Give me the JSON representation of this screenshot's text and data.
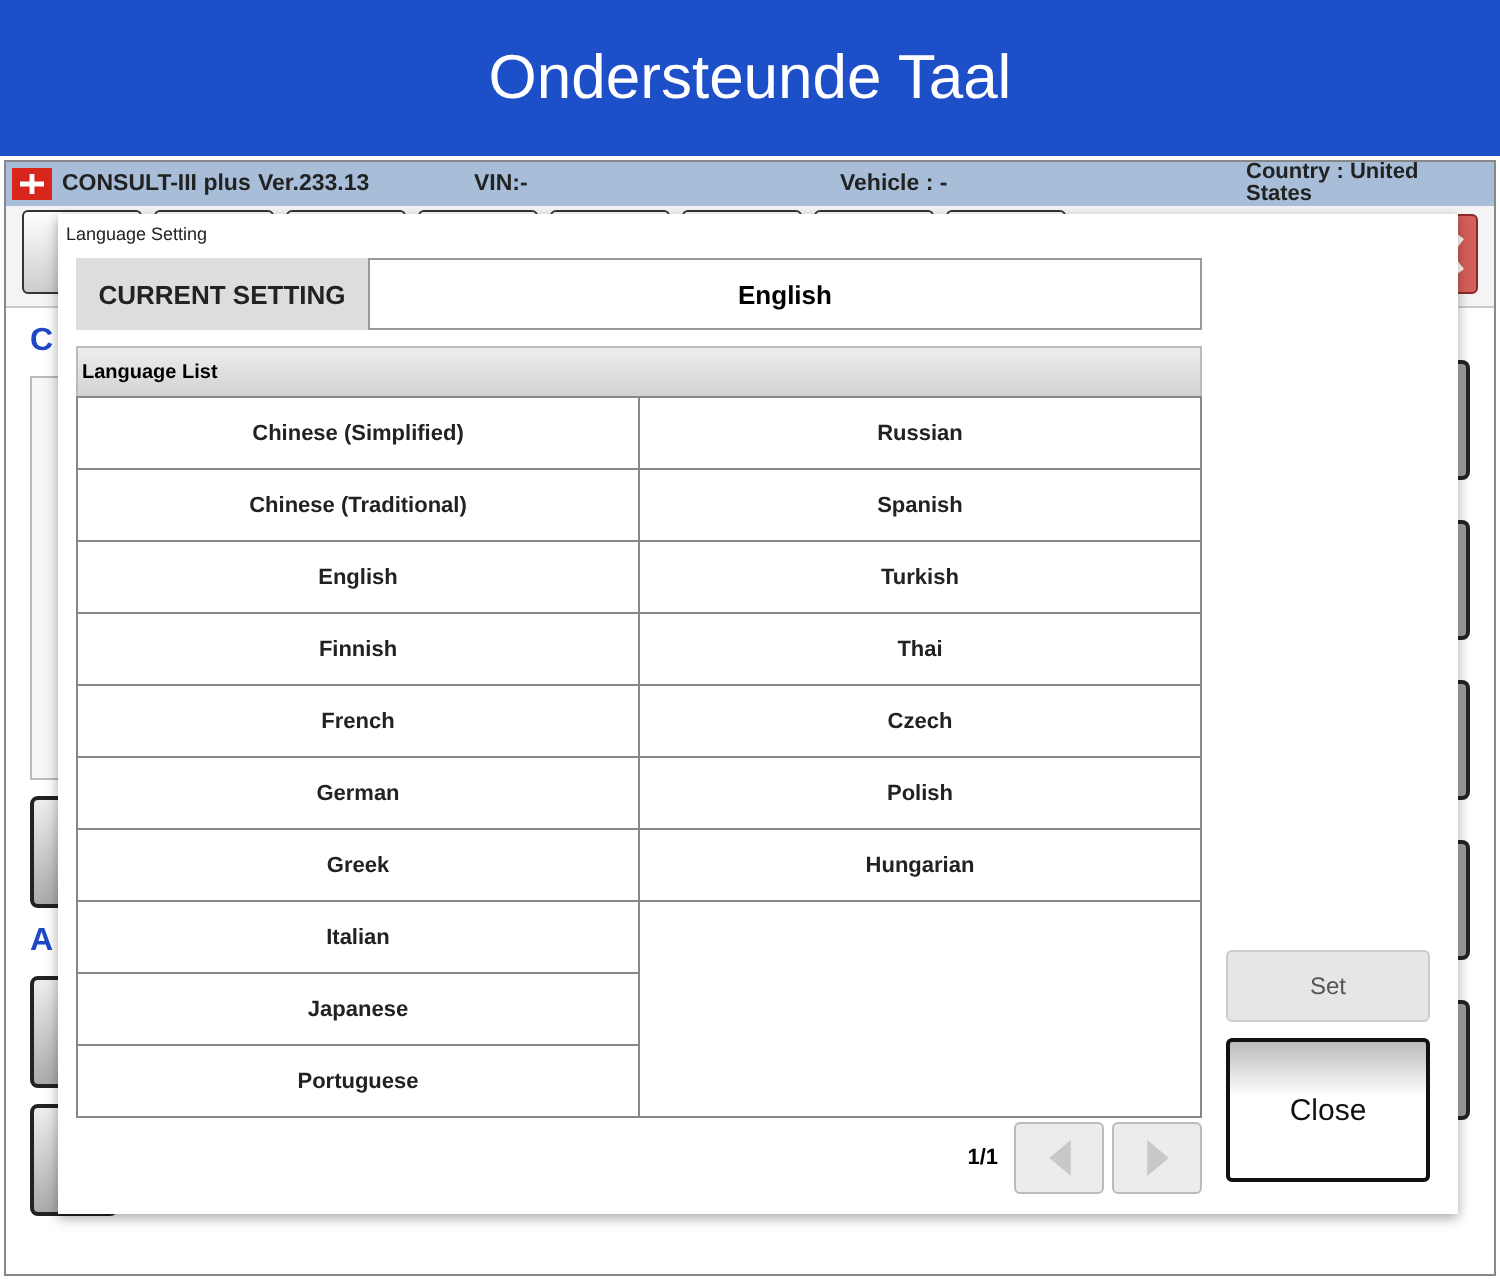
{
  "banner": {
    "title": "Ondersteunde Taal"
  },
  "app_header": {
    "app_name": "CONSULT-III plus",
    "version": "Ver.233.13",
    "vin": "VIN:-",
    "vehicle": "Vehicle : -",
    "country": "Country : United States"
  },
  "background_sections": [
    "C",
    "A"
  ],
  "dialog": {
    "title": "Language Setting",
    "current_setting": {
      "label": "CURRENT SETTING",
      "value": "English"
    },
    "list_header": "Language List",
    "language_columns": [
      {
        "items": [
          {
            "label": "Chinese (Simplified)",
            "selected": false
          },
          {
            "label": "Chinese (Traditional)",
            "selected": false
          },
          {
            "label": "English",
            "selected": false
          },
          {
            "label": "Finnish",
            "selected": false
          },
          {
            "label": "French",
            "selected": false
          },
          {
            "label": "German",
            "selected": false
          },
          {
            "label": "Greek",
            "selected": false
          },
          {
            "label": "Italian",
            "selected": false
          },
          {
            "label": "Japanese",
            "selected": false
          },
          {
            "label": "Portuguese",
            "selected": false
          }
        ]
      },
      {
        "items": [
          {
            "label": "Russian",
            "selected": false
          },
          {
            "label": "Spanish",
            "selected": false
          },
          {
            "label": "Turkish",
            "selected": false
          },
          {
            "label": "Thai",
            "selected": false
          },
          {
            "label": "Czech",
            "selected": false
          },
          {
            "label": "Polish",
            "selected": false
          },
          {
            "label": "Hungarian",
            "selected": false
          }
        ]
      }
    ],
    "page": "1/1",
    "prev_disabled": true,
    "next_disabled": true,
    "set_button": {
      "label": "Set",
      "disabled": true
    },
    "close_button": {
      "label": "Close"
    }
  }
}
